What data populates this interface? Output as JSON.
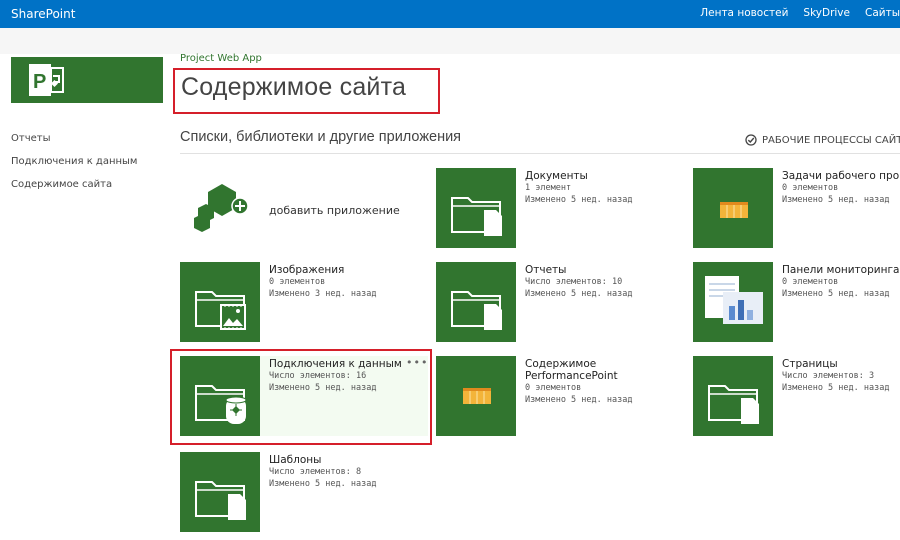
{
  "suitebar": {
    "brand": "SharePoint",
    "links": [
      "Лента новостей",
      "SkyDrive",
      "Сайты"
    ]
  },
  "site": {
    "name": "Project Web App",
    "title": "Содержимое сайта"
  },
  "leftnav": {
    "items": [
      "Отчеты",
      "Подключения к данным",
      "Содержимое сайта"
    ]
  },
  "section": {
    "title": "Списки, библиотеки и другие приложения",
    "workflows_label": "РАБОЧИЕ ПРОЦЕССЫ САЙТА"
  },
  "add_app": {
    "label": "добавить приложение"
  },
  "tiles": [
    {
      "name": "Документы",
      "count": "1 элемент",
      "modified": "Изменено 5 нед. назад",
      "icon": "document-library-icon"
    },
    {
      "name": "Задачи рабочего процесса",
      "count": "0 элементов",
      "modified": "Изменено 5 нед. назад",
      "icon": "task-list-icon"
    },
    {
      "name": "Изображения",
      "count": "0 элементов",
      "modified": "Изменено 3 нед. назад",
      "icon": "picture-library-icon"
    },
    {
      "name": "Отчеты",
      "count": "Число элементов: 10",
      "modified": "Изменено 5 нед. назад",
      "icon": "document-library-icon"
    },
    {
      "name": "Панели мониторинга",
      "count": "0 элементов",
      "modified": "Изменено 5 нед. назад",
      "icon": "dashboard-icon"
    },
    {
      "name": "Подключения к данным",
      "count": "Число элементов: 16",
      "modified": "Изменено 5 нед. назад",
      "icon": "data-connection-library-icon"
    },
    {
      "name": "Содержимое PerformancePoint",
      "count": "0 элементов",
      "modified": "Изменено 5 нед. назад",
      "icon": "list-icon"
    },
    {
      "name": "Страницы",
      "count": "Число элементов: 3",
      "modified": "Изменено 5 нед. назад",
      "icon": "document-library-icon"
    },
    {
      "name": "Шаблоны",
      "count": "Число элементов: 8",
      "modified": "Изменено 5 нед. назад",
      "icon": "document-library-icon"
    }
  ],
  "tile_menu": "•••",
  "colors": {
    "suitebar": "#0072c6",
    "tile_green": "#31752f",
    "highlight_red": "#d51f2a"
  }
}
